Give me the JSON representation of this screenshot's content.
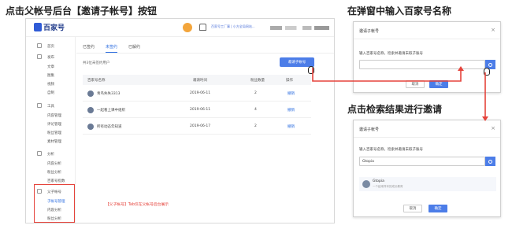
{
  "captions": {
    "step1": "点击父帐号后台【邀请子帐号】按钮",
    "step2": "在弹窗中输入百家号名称",
    "step3": "点击检索结果进行邀请"
  },
  "topbar": {
    "logo": "百家号",
    "notice": "百家号工厂事 | 小方全局网站..."
  },
  "sidebar": {
    "items": [
      {
        "label": "首页"
      },
      {
        "label": "发布"
      },
      {
        "label": "文章"
      },
      {
        "label": "图集"
      },
      {
        "label": "视频"
      },
      {
        "label": "自制"
      },
      {
        "label": "工具"
      },
      {
        "label": "内容管理"
      },
      {
        "label": "评论管理"
      },
      {
        "label": "粉丝管理"
      },
      {
        "label": "素材管理"
      },
      {
        "label": "分析"
      },
      {
        "label": "内容分析"
      },
      {
        "label": "粉丝分析"
      },
      {
        "label": "百家号指数"
      },
      {
        "label": "父子帐号"
      },
      {
        "label": "子帐号管理"
      },
      {
        "label": "内容分析"
      },
      {
        "label": "粉丝分析"
      }
    ]
  },
  "main": {
    "tabs": [
      "已签约",
      "未签约",
      "已解约"
    ],
    "count_text": "共3位未签约用户",
    "invite_button": "邀请子帐号",
    "columns": [
      "百家号名称",
      "邀请时间",
      "粉丝数量",
      "操作"
    ],
    "rows": [
      {
        "name": "青鸟失失3313",
        "date": "2019-06-11",
        "fans": "2",
        "action": "撤销"
      },
      {
        "name": "一起看上课中组织",
        "date": "2019-06-11",
        "fans": "4",
        "action": "撤销"
      },
      {
        "name": "所有动态年知道",
        "date": "2019-06-17",
        "fans": "2",
        "action": "撤销"
      }
    ],
    "note": "【父子帐号】Tab仅在父帐号后台展示"
  },
  "modal1": {
    "title": "邀请子帐号",
    "label": "输入百家号名称，检索并邀请未取子账号",
    "cancel": "取消",
    "confirm": "确定"
  },
  "modal2": {
    "title": "邀请子帐号",
    "label": "输入百家号名称，检索并邀请未取子账号",
    "value": "Gtopia",
    "result_name": "Gtopia",
    "result_desc": "一个起来样本的成长教育",
    "cancel": "取消",
    "confirm": "确定"
  },
  "colors": {
    "accent": "#4c7de8",
    "highlight": "#e5433b"
  },
  "icons": [
    "logo-icon",
    "avatar-icon",
    "bell-icon",
    "search-icon",
    "close-icon",
    "cursor-icon",
    "hand-icon",
    "arrow-icon"
  ]
}
